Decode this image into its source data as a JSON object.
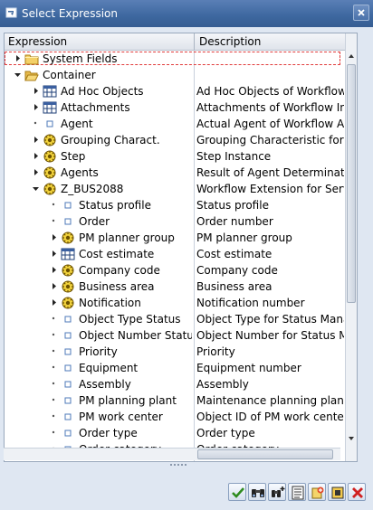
{
  "window": {
    "title": "Select Expression"
  },
  "columns": {
    "expression": "Expression",
    "description": "Description"
  },
  "rows": [
    {
      "level": 0,
      "node": "closed",
      "icon": "folder-icon",
      "label": "System Fields",
      "desc": "",
      "selected": true
    },
    {
      "level": 0,
      "node": "open",
      "icon": "folder-open-icon",
      "label": "Container",
      "desc": ""
    },
    {
      "level": 1,
      "node": "closed",
      "icon": "structure-icon",
      "label": "Ad Hoc Objects",
      "desc": "Ad Hoc Objects of Workflow"
    },
    {
      "level": 1,
      "node": "closed",
      "icon": "structure-icon",
      "label": "Attachments",
      "desc": "Attachments of Workflow Ins"
    },
    {
      "level": 1,
      "node": "leaf",
      "icon": "field-icon",
      "label": "Agent",
      "desc": "Actual Agent of Workflow Ac"
    },
    {
      "level": 1,
      "node": "closed",
      "icon": "object-icon",
      "label": "Grouping Charact.",
      "desc": "Grouping Characteristic for W"
    },
    {
      "level": 1,
      "node": "closed",
      "icon": "object-icon",
      "label": "Step",
      "desc": "Step Instance"
    },
    {
      "level": 1,
      "node": "closed",
      "icon": "object-icon",
      "label": "Agents",
      "desc": "Result of Agent Determinatio"
    },
    {
      "level": 1,
      "node": "open",
      "icon": "object-icon",
      "label": "Z_BUS2088",
      "desc": "Workflow Extension for Servi"
    },
    {
      "level": 2,
      "node": "leaf",
      "icon": "field-icon",
      "label": "Status profile",
      "desc": "Status profile"
    },
    {
      "level": 2,
      "node": "leaf",
      "icon": "field-icon",
      "label": "Order",
      "desc": "Order number"
    },
    {
      "level": 2,
      "node": "closed",
      "icon": "object-icon",
      "label": "PM planner group",
      "desc": "PM planner group"
    },
    {
      "level": 2,
      "node": "closed",
      "icon": "structure-icon",
      "label": "Cost estimate",
      "desc": "Cost estimate"
    },
    {
      "level": 2,
      "node": "closed",
      "icon": "object-icon",
      "label": "Company code",
      "desc": "Company code"
    },
    {
      "level": 2,
      "node": "closed",
      "icon": "object-icon",
      "label": "Business area",
      "desc": "Business area"
    },
    {
      "level": 2,
      "node": "closed",
      "icon": "object-icon",
      "label": "Notification",
      "desc": "Notification number"
    },
    {
      "level": 2,
      "node": "leaf",
      "icon": "field-icon",
      "label": "Object Type Status",
      "desc": "Object Type for Status Mana"
    },
    {
      "level": 2,
      "node": "leaf",
      "icon": "field-icon",
      "label": "Object Number Status",
      "desc": "Object Number for Status Ma"
    },
    {
      "level": 2,
      "node": "leaf",
      "icon": "field-icon",
      "label": "Priority",
      "desc": "Priority"
    },
    {
      "level": 2,
      "node": "leaf",
      "icon": "field-icon",
      "label": "Equipment",
      "desc": "Equipment number"
    },
    {
      "level": 2,
      "node": "leaf",
      "icon": "field-icon",
      "label": "Assembly",
      "desc": "Assembly"
    },
    {
      "level": 2,
      "node": "leaf",
      "icon": "field-icon",
      "label": "PM planning plant",
      "desc": "Maintenance planning plant"
    },
    {
      "level": 2,
      "node": "leaf",
      "icon": "field-icon",
      "label": "PM work center",
      "desc": "Object ID of PM work center"
    },
    {
      "level": 2,
      "node": "leaf",
      "icon": "field-icon",
      "label": "Order type",
      "desc": "Order type"
    },
    {
      "level": 2,
      "node": "leaf",
      "icon": "field-icon",
      "label": "Order category",
      "desc": "Order category"
    }
  ],
  "toolbar": [
    {
      "name": "confirm-button",
      "icon": "check-icon"
    },
    {
      "name": "binoculars-button",
      "icon": "binoculars-icon"
    },
    {
      "name": "find-next-button",
      "icon": "binoculars-plus-icon"
    },
    {
      "name": "details-button",
      "icon": "list-icon"
    },
    {
      "name": "create-button",
      "icon": "create-icon"
    },
    {
      "name": "expand-button",
      "icon": "expand-icon"
    },
    {
      "name": "cancel-button",
      "icon": "cancel-icon"
    }
  ],
  "colors": {
    "titlebar": "#3d679f",
    "selection": "#e13c3c",
    "confirm": "#2e8b1e",
    "cancel": "#d02020"
  }
}
